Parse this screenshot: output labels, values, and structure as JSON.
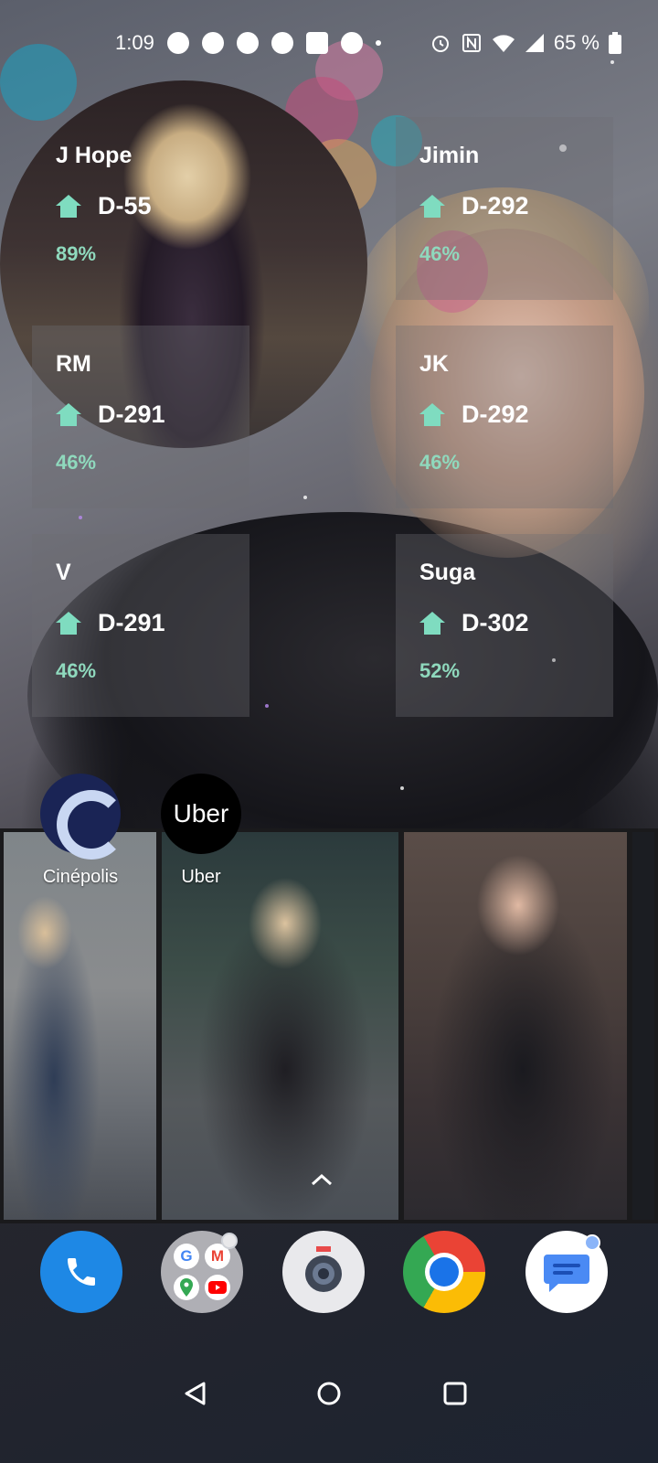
{
  "status_bar": {
    "time": "1:09",
    "battery_percent": "65 %",
    "left_icons": [
      "whatsapp-icon",
      "chat-bubble-icon",
      "messenger-icon",
      "messenger-icon",
      "app-icon",
      "facebook-icon",
      "more-dot-icon"
    ],
    "right_icons": [
      "alarm-icon",
      "nfc-icon",
      "wifi-icon",
      "signal-icon",
      "battery-icon"
    ]
  },
  "widgets": [
    {
      "name": "J Hope",
      "dday": "D-55",
      "percent": "89%"
    },
    {
      "name": "Jimin",
      "dday": "D-292",
      "percent": "46%"
    },
    {
      "name": "RM",
      "dday": "D-291",
      "percent": "46%"
    },
    {
      "name": "JK",
      "dday": "D-292",
      "percent": "46%"
    },
    {
      "name": "V",
      "dday": "D-291",
      "percent": "46%"
    },
    {
      "name": "Suga",
      "dday": "D-302",
      "percent": "52%"
    }
  ],
  "apps": [
    {
      "label": "Cinépolis",
      "icon": "cinepolis-icon"
    },
    {
      "label": "Uber",
      "icon": "uber-icon",
      "icon_text": "Uber"
    }
  ],
  "dock": [
    "phone-icon",
    "google-apps-folder-icon",
    "camera-icon",
    "chrome-icon",
    "messages-icon"
  ],
  "folder_letters": [
    "G",
    "M"
  ],
  "nav": [
    "back-icon",
    "home-icon",
    "recents-icon"
  ],
  "colors": {
    "accent_mint": "#7fdcc0",
    "percent_mint": "#8fd9bd",
    "phone_blue": "#1e88e5"
  }
}
